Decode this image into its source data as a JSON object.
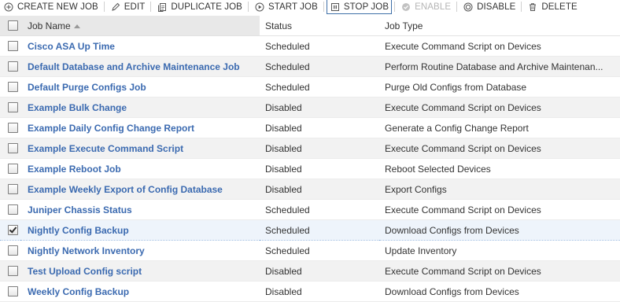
{
  "toolbar": {
    "create": "CREATE NEW JOB",
    "edit": "EDIT",
    "duplicate": "DUPLICATE JOB",
    "start": "START JOB",
    "stop": "STOP JOB",
    "enable": "ENABLE",
    "disable": "DISABLE",
    "delete": "DELETE"
  },
  "columns": {
    "name": "Job Name",
    "status": "Status",
    "type": "Job Type"
  },
  "rows": [
    {
      "name": "Cisco ASA Up Time",
      "status": "Scheduled",
      "type": "Execute Command Script on Devices",
      "checked": false
    },
    {
      "name": "Default Database and Archive Maintenance Job",
      "status": "Scheduled",
      "type": "Perform Routine Database and Archive Maintenan...",
      "checked": false
    },
    {
      "name": "Default Purge Configs Job",
      "status": "Scheduled",
      "type": "Purge Old Configs from Database",
      "checked": false
    },
    {
      "name": "Example Bulk Change",
      "status": "Disabled",
      "type": "Execute Command Script on Devices",
      "checked": false
    },
    {
      "name": "Example Daily Config Change Report",
      "status": "Disabled",
      "type": "Generate a Config Change Report",
      "checked": false
    },
    {
      "name": "Example Execute Command Script",
      "status": "Disabled",
      "type": "Execute Command Script on Devices",
      "checked": false
    },
    {
      "name": "Example Reboot Job",
      "status": "Disabled",
      "type": "Reboot Selected Devices",
      "checked": false
    },
    {
      "name": "Example Weekly Export of Config Database",
      "status": "Disabled",
      "type": "Export Configs",
      "checked": false
    },
    {
      "name": "Juniper Chassis Status",
      "status": "Scheduled",
      "type": "Execute Command Script on Devices",
      "checked": false
    },
    {
      "name": "Nightly Config Backup",
      "status": "Scheduled",
      "type": "Download Configs from Devices",
      "checked": true
    },
    {
      "name": "Nightly Network Inventory",
      "status": "Scheduled",
      "type": "Update Inventory",
      "checked": false
    },
    {
      "name": "Test Upload Config script",
      "status": "Disabled",
      "type": "Execute Command Script on Devices",
      "checked": false
    },
    {
      "name": "Weekly Config Backup",
      "status": "Disabled",
      "type": "Download Configs from Devices",
      "checked": false
    }
  ]
}
